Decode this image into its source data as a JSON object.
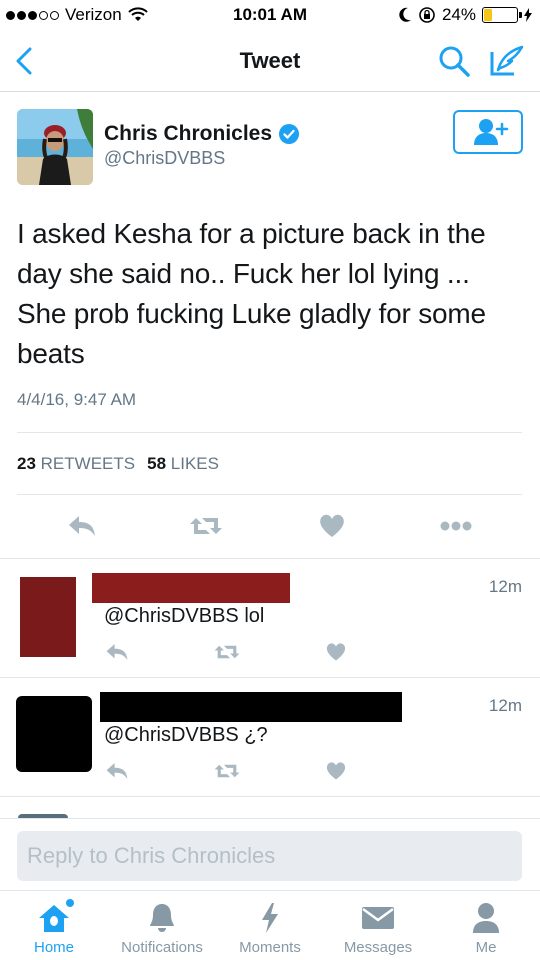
{
  "status_bar": {
    "carrier": "Verizon",
    "time": "10:01 AM",
    "battery_percent": "24%",
    "battery_level": 0.24
  },
  "nav": {
    "title": "Tweet"
  },
  "tweet": {
    "name": "Chris Chronicles",
    "handle": "@ChrisDVBBS",
    "text": "I asked Kesha for a picture back in the day she said no.. Fuck her lol lying ... She prob fucking Luke gladly for some beats",
    "timestamp": "4/4/16, 9:47 AM",
    "retweets_count": "23",
    "retweets_label": "RETWEETS",
    "likes_count": "58",
    "likes_label": "LIKES"
  },
  "replies": [
    {
      "text": "@ChrisDVBBS lol",
      "time": "12m",
      "avatar_color": "#7b1a1a"
    },
    {
      "text": "@ChrisDVBBS ¿?",
      "time": "12m",
      "avatar_color": "#000000"
    }
  ],
  "reply_bar": {
    "placeholder": "Reply to Chris Chronicles"
  },
  "tabs": [
    {
      "label": "Home",
      "icon": "home-icon"
    },
    {
      "label": "Notifications",
      "icon": "bell-icon"
    },
    {
      "label": "Moments",
      "icon": "lightning-icon"
    },
    {
      "label": "Messages",
      "icon": "envelope-icon"
    },
    {
      "label": "Me",
      "icon": "person-icon"
    }
  ],
  "colors": {
    "accent": "#1da1f2",
    "text_secondary": "#657786",
    "icon_gray": "#aab8c2"
  }
}
